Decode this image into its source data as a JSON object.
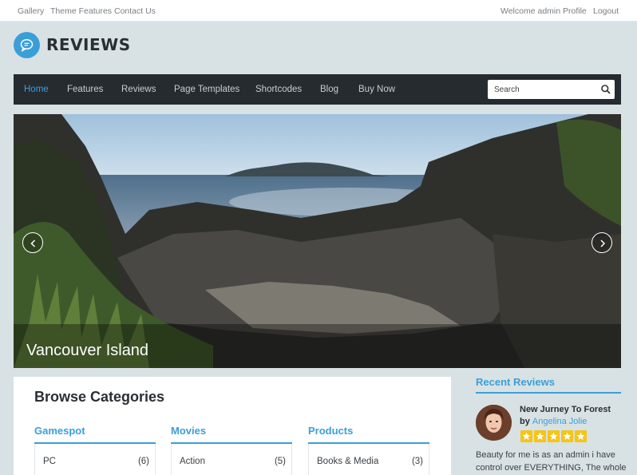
{
  "topbar": {
    "left_links": [
      "Gallery",
      "Theme Features",
      "Contact Us"
    ],
    "right_links": [
      "Welcome admin",
      "Profile",
      "Logout"
    ]
  },
  "brand": {
    "name": "REVIEWS",
    "accent": "#3a9fd8",
    "icon": "speech-bubble-icon"
  },
  "nav": {
    "items": [
      "Home",
      "Features",
      "Reviews",
      "Page Templates",
      "Shortcodes",
      "Blog",
      "Buy Now"
    ],
    "active": "Home",
    "search_placeholder": "Search",
    "search_icon": "search-icon"
  },
  "slider": {
    "caption": "Vancouver Island",
    "prev_icon": "chevron-left-icon",
    "next_icon": "chevron-right-icon"
  },
  "browse": {
    "title": "Browse Categories",
    "columns": [
      {
        "title": "Gamespot",
        "items": [
          {
            "name": "PC",
            "count": "(6)"
          }
        ]
      },
      {
        "title": "Movies",
        "items": [
          {
            "name": "Action",
            "count": "(5)"
          }
        ]
      },
      {
        "title": "Products",
        "items": [
          {
            "name": "Books & Media",
            "count": "(3)"
          }
        ]
      }
    ]
  },
  "recent_reviews": {
    "title": "Recent Reviews",
    "items": [
      {
        "title": "New Jurney To Forest",
        "by_label": "by",
        "author": "Angelina Jolie",
        "rating": 5,
        "excerpt": "Beauty for me is as an admin i have control over EVERYTHING, The whole"
      }
    ]
  },
  "colors": {
    "accent": "#3a9fd8",
    "nav_bg": "#262b30",
    "page_bg": "#d8e2e4",
    "star": "#f5c518"
  }
}
